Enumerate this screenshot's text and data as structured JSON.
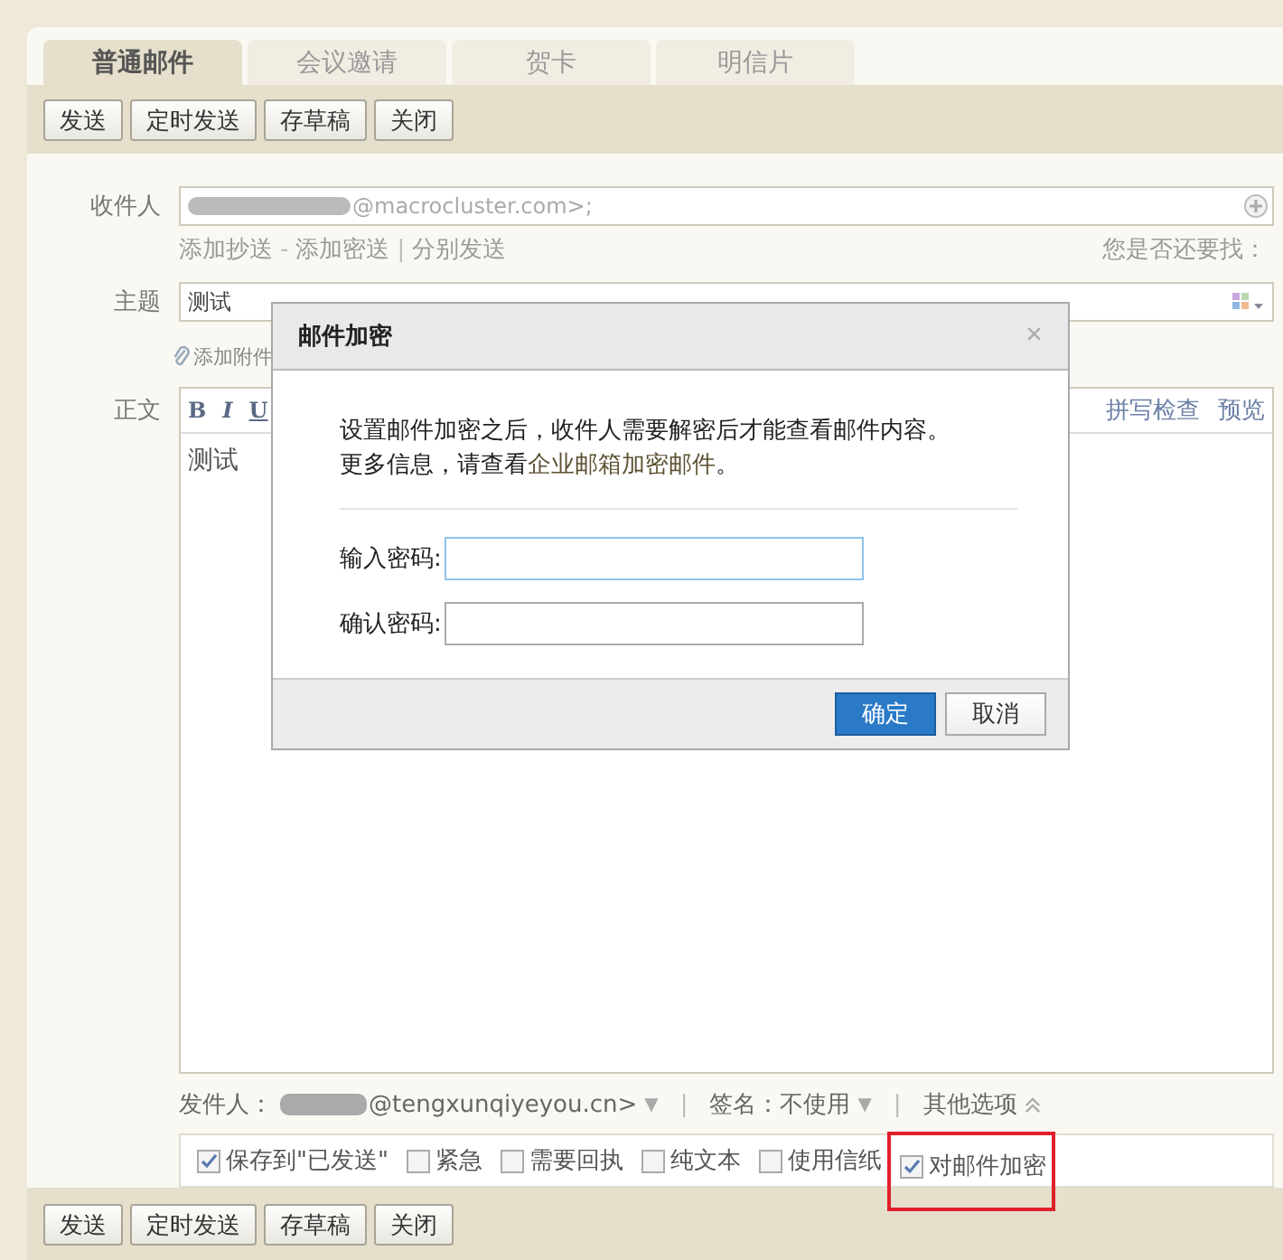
{
  "tabs": [
    {
      "label": "普通邮件",
      "selected": true
    },
    {
      "label": "会议邀请",
      "selected": false
    },
    {
      "label": "贺卡",
      "selected": false
    },
    {
      "label": "明信片",
      "selected": false
    }
  ],
  "toolbar_top": [
    "发送",
    "定时发送",
    "存草稿",
    "关闭"
  ],
  "recipient": {
    "label": "收件人",
    "value": "@macrocluster.com>;"
  },
  "cc_links": [
    {
      "kind": "link",
      "text": "添加抄送"
    },
    {
      "kind": "separator",
      "text": "-"
    },
    {
      "kind": "link",
      "text": "添加密送"
    },
    {
      "kind": "separator",
      "text": "|"
    },
    {
      "kind": "link",
      "text": "分别发送"
    }
  ],
  "suggest_label": "您是否还要找：",
  "subject": {
    "label": "主题",
    "value": "测试"
  },
  "attach": "添加附件",
  "body": {
    "label": "正文",
    "format_buttons": [
      "B",
      "I",
      "U"
    ],
    "links": [
      "拼写检查",
      "预览"
    ],
    "text": "测试"
  },
  "sender": {
    "label": "发件人：",
    "value": "@tengxunqiyeyou.cn>",
    "caret": "▼"
  },
  "dividers": [
    "|",
    "|"
  ],
  "signature": {
    "label": "签名：",
    "value": "不使用",
    "caret": "▼"
  },
  "more_options": "其他选项",
  "options": [
    {
      "label": "保存到\"已发送\"",
      "checked": true,
      "highlighted": false
    },
    {
      "label": "紧急",
      "checked": false,
      "highlighted": false
    },
    {
      "label": "需要回执",
      "checked": false,
      "highlighted": false
    },
    {
      "label": "纯文本",
      "checked": false,
      "highlighted": false
    },
    {
      "label": "使用信纸",
      "checked": false,
      "highlighted": false
    },
    {
      "label": "对邮件加密",
      "checked": true,
      "highlighted": true
    }
  ],
  "toolbar_bottom": [
    "发送",
    "定时发送",
    "存草稿",
    "关闭"
  ],
  "dialog": {
    "title": "邮件加密",
    "close": "×",
    "text": "设置邮件加密之后，收件人需要解密后才能查看邮件内容。",
    "more_prefix": "更多信息，请查看",
    "more_link": "企业邮箱加密邮件",
    "more_suffix": "。",
    "fields": [
      {
        "label": "输入密码:",
        "focused": true
      },
      {
        "label": "确认密码:",
        "focused": false
      }
    ],
    "buttons": [
      {
        "label": "确定",
        "kind": "primary"
      },
      {
        "label": "取消",
        "kind": "default"
      }
    ]
  }
}
